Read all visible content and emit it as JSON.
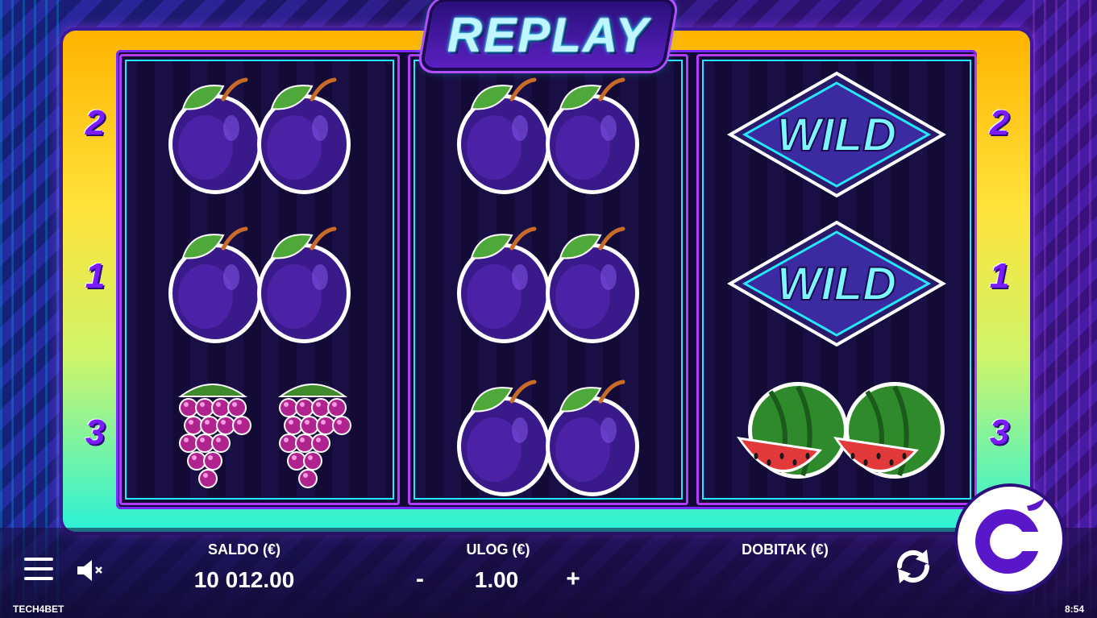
{
  "game": {
    "title": "REPLAY"
  },
  "lines": {
    "left": [
      "2",
      "1",
      "3"
    ],
    "right": [
      "2",
      "1",
      "3"
    ]
  },
  "reels": [
    [
      "plum",
      "plum",
      "grapes"
    ],
    [
      "plum",
      "plum",
      "plum"
    ],
    [
      "wild",
      "wild",
      "watermelon"
    ]
  ],
  "wild_label": "WILD",
  "panel": {
    "saldo_label": "SALDO (€)",
    "saldo_value": "10 012.00",
    "ulog_label": "ULOG (€)",
    "ulog_value": "1.00",
    "minus": "-",
    "plus": "+",
    "dobitak_label": "DOBITAK (€)"
  },
  "footer": {
    "brand": "TECH4BET",
    "clock": "8:54"
  },
  "icons": {
    "menu": "hamburger-menu-icon",
    "sound": "sound-muted-icon",
    "autoplay": "refresh-icon",
    "spin": "spin-icon"
  },
  "colors": {
    "frame_top": "#ffb300",
    "frame_bottom": "#2af2d8",
    "accent": "#b43cff",
    "cyan": "#27e6ff"
  }
}
